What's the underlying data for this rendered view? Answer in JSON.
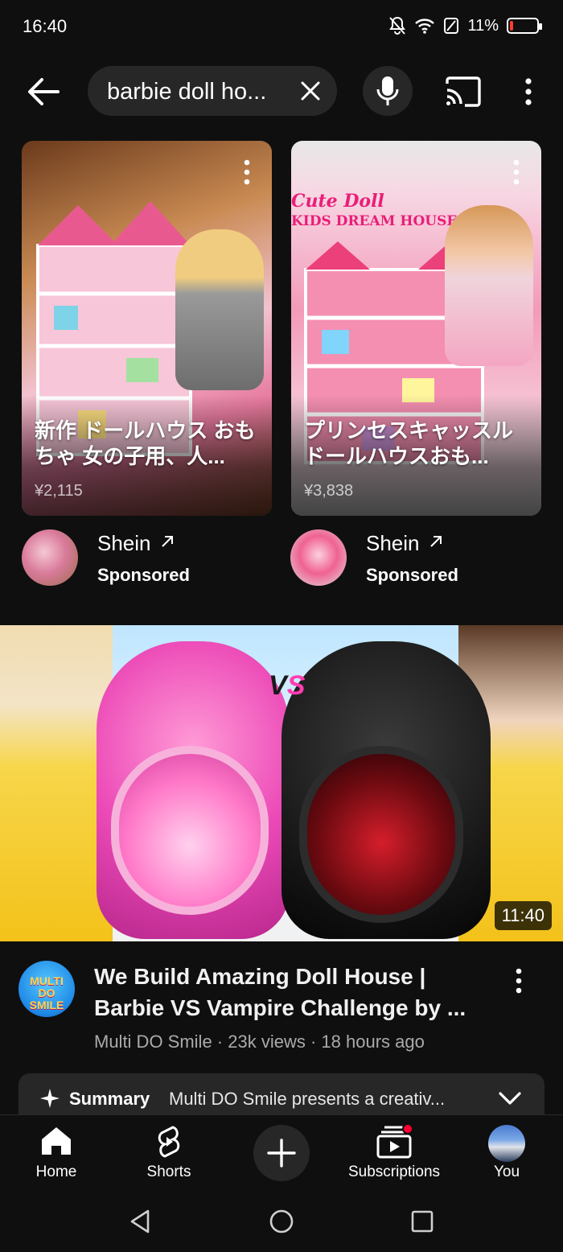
{
  "status_bar": {
    "time": "16:40",
    "battery_percent": "11%",
    "battery_level": 0.11,
    "battery_color": "#ff3b30"
  },
  "top_bar": {
    "search_query": "barbie doll ho..."
  },
  "ads": [
    {
      "title": "新作 ドールハウス おもちゃ 女の子用、人...",
      "price": "¥2,115",
      "banner_line1": "",
      "banner_line2": "",
      "advertiser": "Shein",
      "sponsored_label": "Sponsored"
    },
    {
      "title": "プリンセスキャッスルドールハウスおも...",
      "price": "¥3,838",
      "banner_line1": "Cute Doll",
      "banner_line2": "KIDS DREAM HOUSE",
      "advertiser": "Shein",
      "sponsored_label": "Sponsored"
    }
  ],
  "video": {
    "duration": "11:40",
    "vs_text_1": "V",
    "vs_text_2": "S",
    "channel_logo_line1": "MULTI",
    "channel_logo_line2": "DO",
    "channel_logo_line3": "SMILE",
    "title": "We Build Amazing Doll House | Barbie VS Vampire Challenge by ...",
    "channel": "Multi DO Smile",
    "views": "23k views",
    "age": "18 hours ago",
    "separator": " · "
  },
  "summary": {
    "label": "Summary",
    "text": "Multi DO Smile presents a creativ..."
  },
  "bottom_nav": {
    "home": "Home",
    "shorts": "Shorts",
    "subscriptions": "Subscriptions",
    "you": "You"
  },
  "colors": {
    "background": "#0f0f0f",
    "surface": "#272727",
    "accent_red": "#ff0033",
    "secondary_text": "#aaaaaa"
  }
}
